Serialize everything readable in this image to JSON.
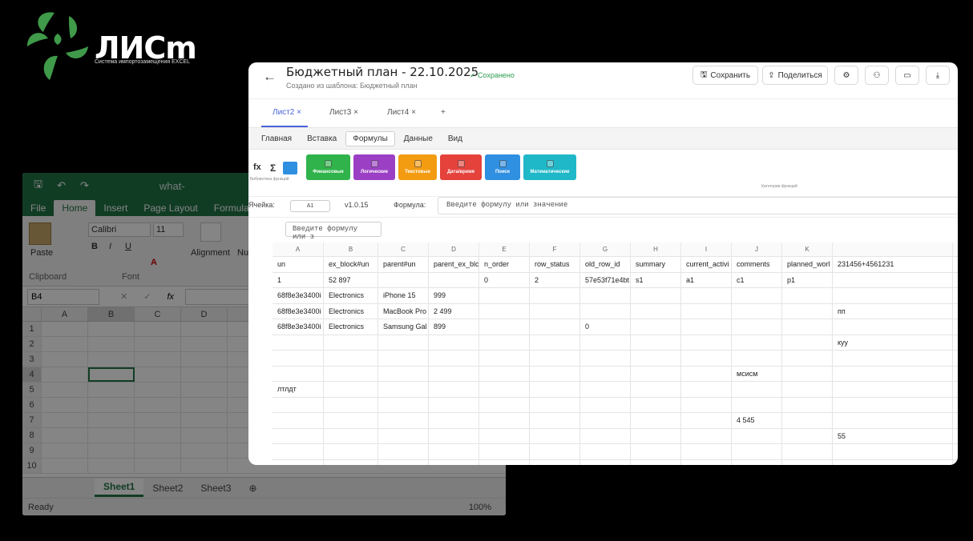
{
  "logo": {
    "name": "ЛИСm",
    "tagline": "Система импортозамещения EXCEL"
  },
  "excel": {
    "title": "what-",
    "tabs": [
      "File",
      "Home",
      "Insert",
      "Page Layout",
      "Formulas"
    ],
    "font_name": "Calibri",
    "font_size": "11",
    "paste_label": "Paste",
    "alignment_label": "Alignment",
    "num_label": "Nu",
    "clipboard_label": "Clipboard",
    "font_label": "Font",
    "name_box": "B4",
    "fx": "fx",
    "columns": [
      "A",
      "B",
      "C",
      "D"
    ],
    "rows": [
      "1",
      "2",
      "3",
      "4",
      "5",
      "6",
      "7",
      "8",
      "9",
      "10"
    ],
    "sheets": [
      "Sheet1",
      "Sheet2",
      "Sheet3"
    ],
    "status": "Ready",
    "zoom": "100%"
  },
  "app": {
    "back_icon": "arrow-left-icon",
    "title": "Бюджетный план - 22.10.2025",
    "subtitle": "Создано из шаблона: Бюджетный план",
    "saved": "✓ Сохранено",
    "save_label": "Сохранить",
    "share_label": "Поделиться",
    "sheet_tabs": [
      "Лист2",
      "Лист3",
      "Лист4"
    ],
    "menu": [
      "Главная",
      "Вставка",
      "Формулы",
      "Данные",
      "Вид"
    ],
    "func_library_label": "Библиотека функций",
    "func_categories_label": "Категории функций",
    "func_buttons": [
      {
        "label": "Финансовые",
        "color": "#2fb34a"
      },
      {
        "label": "Логические",
        "color": "#9b3fc4"
      },
      {
        "label": "Текстовые",
        "color": "#f39c12"
      },
      {
        "label": "Дата/время",
        "color": "#e5423c"
      },
      {
        "label": "Поиск",
        "color": "#2f8fe0"
      },
      {
        "label": "Математические",
        "color": "#1fb8c8"
      }
    ],
    "cell_label": "Ячейка:",
    "cell_value": "A1",
    "version": "v1.0.15",
    "formula_label": "Формула:",
    "formula_placeholder": "Введите формулу или значение",
    "input2_placeholder": "Введите формулу или з",
    "accent_color": "#4a63d8"
  },
  "sheet": {
    "columns": [
      "A",
      "B",
      "C",
      "D",
      "E",
      "F",
      "G",
      "H",
      "I",
      "J",
      "K",
      ""
    ],
    "rows": [
      [
        "un",
        "ex_block#un",
        "parent#un",
        "parent_ex_blc",
        "n_order",
        "row_status",
        "old_row_id",
        "summary",
        "current_activi",
        "comments",
        "planned_worl",
        "231456+4561231"
      ],
      [
        "1",
        "52 897",
        "",
        "",
        "0",
        "2",
        "57e53f71e4bt",
        "s1",
        "a1",
        "c1",
        "p1",
        ""
      ],
      [
        "68f8e3e3400i",
        "Electronics",
        "iPhone 15",
        "999",
        "",
        "",
        "",
        "",
        "",
        "",
        "",
        ""
      ],
      [
        "68f8e3e3400i",
        "Electronics",
        "MacBook Pro",
        "2 499",
        "",
        "",
        "",
        "",
        "",
        "",
        "",
        "пп"
      ],
      [
        "68f8e3e3400i",
        "Electronics",
        "Samsung Gal",
        "899",
        "",
        "",
        "0",
        "",
        "",
        "",
        "",
        ""
      ],
      [
        "",
        "",
        "",
        "",
        "",
        "",
        "",
        "",
        "",
        "",
        "",
        "куу"
      ],
      [
        "",
        "",
        "",
        "",
        "",
        "",
        "",
        "",
        "",
        "",
        "",
        ""
      ],
      [
        "",
        "",
        "",
        "",
        "",
        "",
        "",
        "",
        "",
        "мсисм",
        "",
        ""
      ],
      [
        "лтлдт",
        "",
        "",
        "",
        "",
        "",
        "",
        "",
        "",
        "",
        "",
        ""
      ],
      [
        "",
        "",
        "",
        "",
        "",
        "",
        "",
        "",
        "",
        "",
        "",
        ""
      ],
      [
        "",
        "",
        "",
        "",
        "",
        "",
        "",
        "",
        "",
        "4 545",
        "",
        ""
      ],
      [
        "",
        "",
        "",
        "",
        "",
        "",
        "",
        "",
        "",
        "",
        "",
        "55"
      ],
      [
        "",
        "",
        "",
        "",
        "",
        "",
        "",
        "",
        "",
        "",
        "",
        ""
      ],
      [
        "",
        "",
        "",
        "",
        "",
        "",
        "",
        "",
        "",
        "",
        "",
        ""
      ]
    ]
  }
}
